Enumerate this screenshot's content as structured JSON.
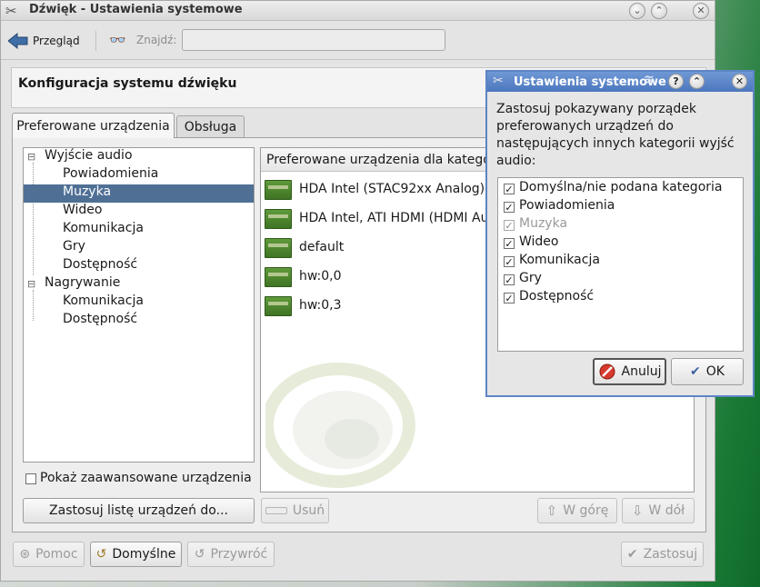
{
  "window": {
    "title": "Dźwięk - Ustawienia systemowe"
  },
  "toolbar": {
    "back_label": "Przegląd",
    "search_label": "Znajdź:",
    "search_value": ""
  },
  "header": {
    "title": "Konfiguracja systemu dźwięku"
  },
  "tabs": [
    {
      "label": "Preferowane urządzenia",
      "active": true
    },
    {
      "label": "Obsługa",
      "active": false
    }
  ],
  "tree": {
    "playback": "Wyjście audio",
    "playback_children": [
      "Powiadomienia",
      "Muzyka",
      "Wideo",
      "Komunikacja",
      "Gry",
      "Dostępność"
    ],
    "selected": "Muzyka",
    "recording": "Nagrywanie",
    "recording_children": [
      "Komunikacja",
      "Dostępność"
    ]
  },
  "device_panel": {
    "header": "Preferowane urządzenia dla kategorii",
    "devices": [
      "HDA Intel (STAC92xx Analog)",
      "HDA Intel, ATI HDMI (HDMI Aud",
      "default",
      "hw:0,0",
      "hw:0,3"
    ]
  },
  "options": {
    "show_advanced": "Pokaż zaawansowane urządzenia",
    "show_advanced_checked": false
  },
  "buttons": {
    "apply_list": "Zastosuj listę urządzeń do...",
    "remove": "Usuń",
    "up": "W górę",
    "down": "W dół",
    "help": "Pomoc",
    "defaults": "Domyślne",
    "reset": "Przywróć",
    "apply": "Zastosuj"
  },
  "dialog": {
    "title": "Ustawienia systemowe",
    "message": "Zastosuj pokazywany porządek preferowanych urządzeń do następujących innych kategorii wyjść audio:",
    "categories": [
      {
        "label": "Domyślna/nie podana kategoria",
        "checked": true,
        "enabled": true
      },
      {
        "label": "Powiadomienia",
        "checked": true,
        "enabled": true
      },
      {
        "label": "Muzyka",
        "checked": true,
        "enabled": false
      },
      {
        "label": "Wideo",
        "checked": true,
        "enabled": true
      },
      {
        "label": "Komunikacja",
        "checked": true,
        "enabled": true
      },
      {
        "label": "Gry",
        "checked": true,
        "enabled": true
      },
      {
        "label": "Dostępność",
        "checked": true,
        "enabled": true
      }
    ],
    "cancel_label": "Anuluj",
    "ok_label": "OK"
  },
  "colors": {
    "selection": "#4f6f95",
    "dialog_title": "#5c85c5",
    "desktop_green": "#1b7a36"
  }
}
